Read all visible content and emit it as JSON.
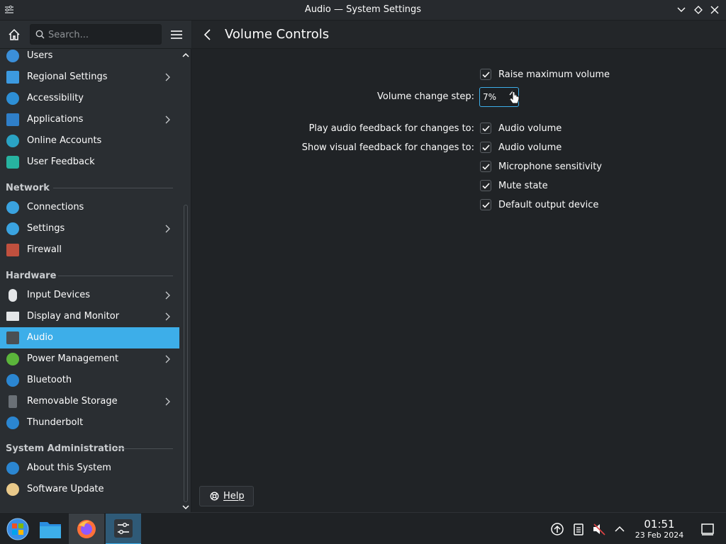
{
  "window": {
    "title": "Audio — System Settings"
  },
  "search": {
    "placeholder": "Search..."
  },
  "main": {
    "title": "Volume Controls"
  },
  "sidebar": {
    "items_top": [
      {
        "label": "Users",
        "icon": "users-icon",
        "chevron": false
      },
      {
        "label": "Regional Settings",
        "icon": "regional-settings-icon",
        "chevron": true
      },
      {
        "label": "Accessibility",
        "icon": "accessibility-icon",
        "chevron": false
      },
      {
        "label": "Applications",
        "icon": "applications-icon",
        "chevron": true
      },
      {
        "label": "Online Accounts",
        "icon": "online-accounts-icon",
        "chevron": false
      },
      {
        "label": "User Feedback",
        "icon": "user-feedback-icon",
        "chevron": false
      }
    ],
    "network_header": "Network",
    "network_items": [
      {
        "label": "Connections",
        "icon": "globe-icon",
        "chevron": false
      },
      {
        "label": "Settings",
        "icon": "globe-icon",
        "chevron": true
      },
      {
        "label": "Firewall",
        "icon": "firewall-icon",
        "chevron": false
      }
    ],
    "hardware_header": "Hardware",
    "hardware_items": [
      {
        "label": "Input Devices",
        "icon": "mouse-icon",
        "chevron": true
      },
      {
        "label": "Display and Monitor",
        "icon": "monitor-icon",
        "chevron": true
      },
      {
        "label": "Audio",
        "icon": "speaker-icon",
        "chevron": false,
        "selected": true
      },
      {
        "label": "Power Management",
        "icon": "power-icon",
        "chevron": true
      },
      {
        "label": "Bluetooth",
        "icon": "bluetooth-icon",
        "chevron": false
      },
      {
        "label": "Removable Storage",
        "icon": "usb-drive-icon",
        "chevron": true
      },
      {
        "label": "Thunderbolt",
        "icon": "thunderbolt-icon",
        "chevron": false
      }
    ],
    "sysadmin_header": "System Administration",
    "sysadmin_items": [
      {
        "label": "About this System",
        "icon": "info-icon",
        "chevron": false
      },
      {
        "label": "Software Update",
        "icon": "software-update-icon",
        "chevron": false
      }
    ]
  },
  "form": {
    "raise_max_volume": {
      "label": "Raise maximum volume",
      "checked": true
    },
    "volume_step": {
      "label": "Volume change step:",
      "value": "7%"
    },
    "audio_feedback": {
      "label": "Play audio feedback for changes to:",
      "option": "Audio volume",
      "checked": true
    },
    "visual_feedback": {
      "label": "Show visual feedback for changes to:",
      "options": [
        {
          "label": "Audio volume",
          "checked": true
        },
        {
          "label": "Microphone sensitivity",
          "checked": true
        },
        {
          "label": "Mute state",
          "checked": true
        },
        {
          "label": "Default output device",
          "checked": true
        }
      ]
    }
  },
  "help_button": {
    "label": "Help"
  },
  "taskbar": {
    "apps": [
      "start-menu-icon",
      "file-manager-icon",
      "firefox-icon",
      "system-settings-icon"
    ],
    "clock": {
      "time": "01:51",
      "date": "23 Feb 2024"
    }
  },
  "colors": {
    "accent": "#3daee9",
    "background": "#202326",
    "sidebar": "#2a2e32"
  }
}
